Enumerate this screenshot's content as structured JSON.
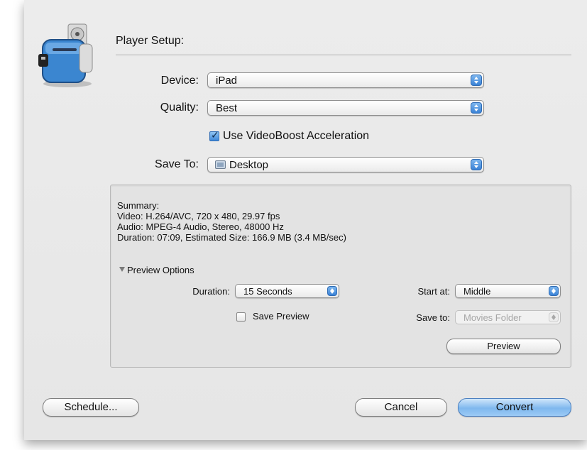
{
  "dialog": {
    "section_title": "Player Setup:",
    "icon": "toaster-app-icon"
  },
  "device": {
    "label": "Device:",
    "value": "iPad"
  },
  "quality": {
    "label": "Quality:",
    "value": "Best"
  },
  "videoboost": {
    "label": "Use VideoBoost Acceleration",
    "checked": true
  },
  "save_to": {
    "label": "Save To:",
    "value": "Desktop",
    "icon": "folder-icon"
  },
  "summary": {
    "heading": "Summary:",
    "video": "Video: H.264/AVC, 720 x 480, 29.97 fps",
    "audio": "Audio: MPEG-4 Audio, Stereo, 48000 Hz",
    "duration": "Duration: 07:09, Estimated Size: 166.9 MB (3.4 MB/sec)"
  },
  "preview": {
    "disclosure_label": "Preview Options",
    "expanded": true,
    "duration_label": "Duration:",
    "duration_value": "15 Seconds",
    "save_preview_label": "Save Preview",
    "save_preview_checked": false,
    "start_at_label": "Start at:",
    "start_at_value": "Middle",
    "save_to_label": "Save to:",
    "save_to_value": "Movies Folder",
    "save_to_enabled": false,
    "preview_button": "Preview"
  },
  "buttons": {
    "schedule": "Schedule...",
    "cancel": "Cancel",
    "convert": "Convert"
  },
  "colors": {
    "accent": "#3a82d6",
    "default_button": "#7fb8ee"
  }
}
